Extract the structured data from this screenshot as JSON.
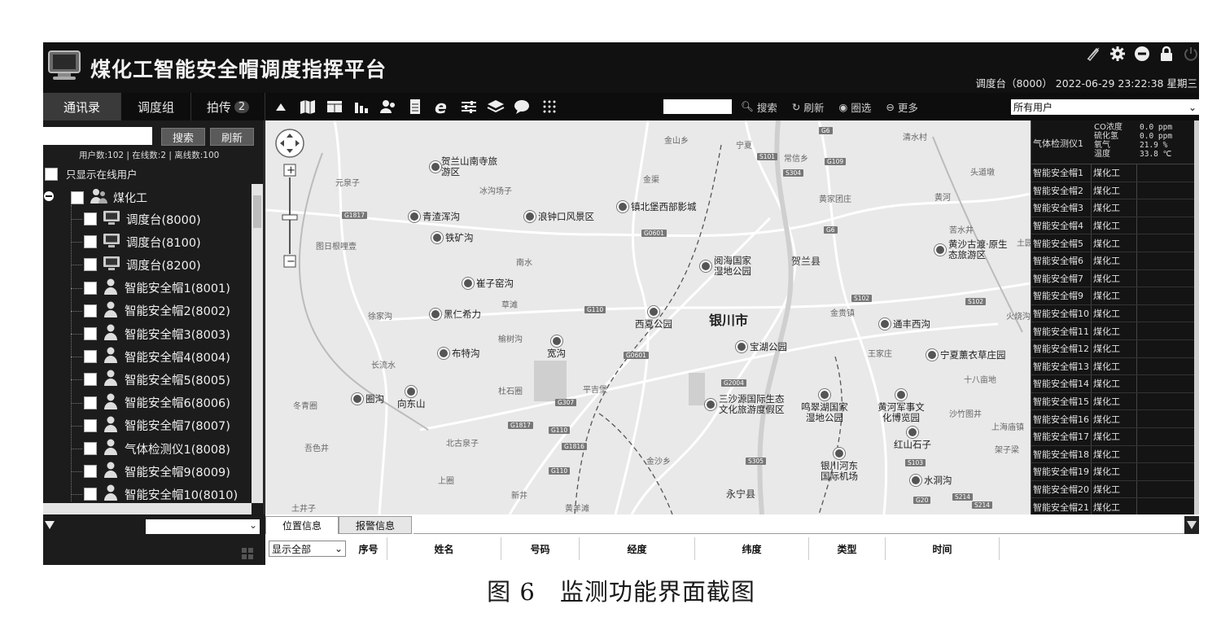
{
  "header": {
    "title": "煤化工智能安全帽调度指挥平台",
    "status_line": "调度台（8000） 2022-06-29 23:22:38 星期三",
    "icons": [
      "pen-icon",
      "gear-icon",
      "minus-icon",
      "lock-icon",
      "power-icon"
    ]
  },
  "tabs": [
    {
      "label": "通讯录",
      "active": true
    },
    {
      "label": "调度组",
      "active": false
    },
    {
      "label": "拍传",
      "count": "2",
      "active": false
    }
  ],
  "toolbar": {
    "icons": [
      "collapse-icon",
      "map-icon",
      "window-icon",
      "bar-chart-icon",
      "users-icon",
      "document-icon",
      "ie-icon",
      "sliders-icon",
      "layers-icon",
      "chat-icon",
      "grid-icon"
    ],
    "search_label": "搜索",
    "refresh_label": "刷新",
    "circle_select_label": "圈选",
    "more_label": "更多",
    "user_filter": "所有用户"
  },
  "left_panel": {
    "search_button": "搜索",
    "refresh_button": "刷新",
    "stats": "用户数:102 | 在线数:2 | 离线数:100",
    "only_online_label": "只显示在线用户",
    "root": "煤化工",
    "items": [
      {
        "label": "调度台(8000)",
        "icon": "monitor-icon"
      },
      {
        "label": "调度台(8100)",
        "icon": "monitor-icon"
      },
      {
        "label": "调度台(8200)",
        "icon": "monitor-icon"
      },
      {
        "label": "智能安全帽1(8001)",
        "icon": "person-icon"
      },
      {
        "label": "智能安全帽2(8002)",
        "icon": "person-icon"
      },
      {
        "label": "智能安全帽3(8003)",
        "icon": "person-icon"
      },
      {
        "label": "智能安全帽4(8004)",
        "icon": "person-icon"
      },
      {
        "label": "智能安全帽5(8005)",
        "icon": "person-icon"
      },
      {
        "label": "智能安全帽6(8006)",
        "icon": "person-icon"
      },
      {
        "label": "智能安全帽7(8007)",
        "icon": "person-icon"
      },
      {
        "label": "气体检测仪1(8008)",
        "icon": "person-icon"
      },
      {
        "label": "智能安全帽9(8009)",
        "icon": "person-icon"
      },
      {
        "label": "智能安全帽10(8010)",
        "icon": "person-icon"
      }
    ]
  },
  "map": {
    "city": "银川市",
    "labels": {
      "jinshan": "金山乡",
      "ningxia": "宁夏",
      "changxin": "常信乡",
      "qingshui": "清水村",
      "toudao": "头道墩",
      "yuanquan": "元泉子",
      "jinqu": "金渠",
      "bingou": "冰沟场子",
      "huangjiatuan": "黄家团庄",
      "huanghe": "黄河",
      "tunri": "图日根哩壹",
      "nanshui": "南水",
      "helan": "贺兰县",
      "kushui": "苦水井",
      "tuyuan": "土园",
      "caoyuan": "草滩",
      "xujiagou": "徐家沟",
      "yushugou": "榆树沟",
      "jinguizhen": "金贵镇",
      "huoshao": "火烧沟",
      "wangjia": "王家庄",
      "changliu": "长流水",
      "shibaqu": "十八亩地",
      "dongqing": "冬青圈",
      "dushiquan": "杜石圈",
      "pingjipu": "平吉堡",
      "shatu": "沙竹图井",
      "shanghai": "上海庙镇",
      "beigu": "北古泉子",
      "jiazi": "架子梁",
      "jinshaxiang": "金沙乡",
      "jiuseying": "吾色井",
      "shangquan": "上圈",
      "xinjing": "新井",
      "yongning": "永宁县",
      "tujingzi": "土井子",
      "huangyang": "黄羊滩"
    },
    "pois": {
      "helanshan": "贺兰山南寺旅游区",
      "qingzhe": "青渣浑沟",
      "langzhong": "浪钟口风景区",
      "zhenbei": "镇北堡西部影城",
      "tiekuang": "铁矿沟",
      "yuehai": "阅海国家湿地公园",
      "huangsha": "黄沙古渡·原生态旅游区",
      "cuizhi": "崔子窑沟",
      "heiren": "黑仁希力",
      "xixia": "西夏公园",
      "tongfeng": "通丰西沟",
      "bute": "布特沟",
      "kuangou": "宽沟",
      "baohu": "宝湖公园",
      "ningxia_xun": "宁夏薰衣草庄园",
      "quangou": "圈沟",
      "xiangdong": "向东山",
      "sanshayuan": "三沙源国际生态文化旅游度假区",
      "mingcui": "鸣翠湖国家湿地公园",
      "junshi": "黄河军事文化博览园",
      "hongshan": "红山石子",
      "airport": "银川河东国际机场",
      "shuidong": "水洞沟"
    },
    "roads": [
      "G6",
      "S101",
      "G109",
      "S304",
      "G1817",
      "G0601",
      "G6",
      "S102",
      "S102",
      "G110",
      "G0601",
      "G2004",
      "G307",
      "G1817",
      "G110",
      "G1816",
      "G110",
      "S305",
      "S103",
      "S214",
      "G20",
      "S214"
    ]
  },
  "right_panel": {
    "gas_device": "气体检测仪1",
    "gas_labels": [
      "CO浓度",
      "硫化氢",
      "氧气",
      "温度"
    ],
    "gas_values": [
      "0.0 ppm",
      "0.0 ppm",
      "21.9 %",
      "33.8 ℃"
    ],
    "rows": [
      {
        "name": "智能安全帽1",
        "org": "煤化工"
      },
      {
        "name": "智能安全帽2",
        "org": "煤化工"
      },
      {
        "name": "智能安全帽3",
        "org": "煤化工"
      },
      {
        "name": "智能安全帽4",
        "org": "煤化工"
      },
      {
        "name": "智能安全帽5",
        "org": "煤化工"
      },
      {
        "name": "智能安全帽6",
        "org": "煤化工"
      },
      {
        "name": "智能安全帽7",
        "org": "煤化工"
      },
      {
        "name": "智能安全帽9",
        "org": "煤化工"
      },
      {
        "name": "智能安全帽10",
        "org": "煤化工"
      },
      {
        "name": "智能安全帽11",
        "org": "煤化工"
      },
      {
        "name": "智能安全帽12",
        "org": "煤化工"
      },
      {
        "name": "智能安全帽13",
        "org": "煤化工"
      },
      {
        "name": "智能安全帽14",
        "org": "煤化工"
      },
      {
        "name": "智能安全帽15",
        "org": "煤化工"
      },
      {
        "name": "智能安全帽16",
        "org": "煤化工"
      },
      {
        "name": "智能安全帽17",
        "org": "煤化工"
      },
      {
        "name": "智能安全帽18",
        "org": "煤化工"
      },
      {
        "name": "智能安全帽19",
        "org": "煤化工"
      },
      {
        "name": "智能安全帽20",
        "org": "煤化工"
      },
      {
        "name": "智能安全帽21",
        "org": "煤化工"
      }
    ]
  },
  "bottom_panel": {
    "tabs": [
      "位置信息",
      "报警信息"
    ],
    "filter": "显示全部",
    "columns": [
      "序号",
      "姓名",
      "号码",
      "经度",
      "纬度",
      "类型",
      "时间"
    ]
  },
  "caption": "图 6　监测功能界面截图",
  "colors": {
    "header_bg": "#111111",
    "panel_bg": "#1c1c1c",
    "map_bg": "#e9e9e9",
    "active_tab": "#3a3a3a"
  }
}
